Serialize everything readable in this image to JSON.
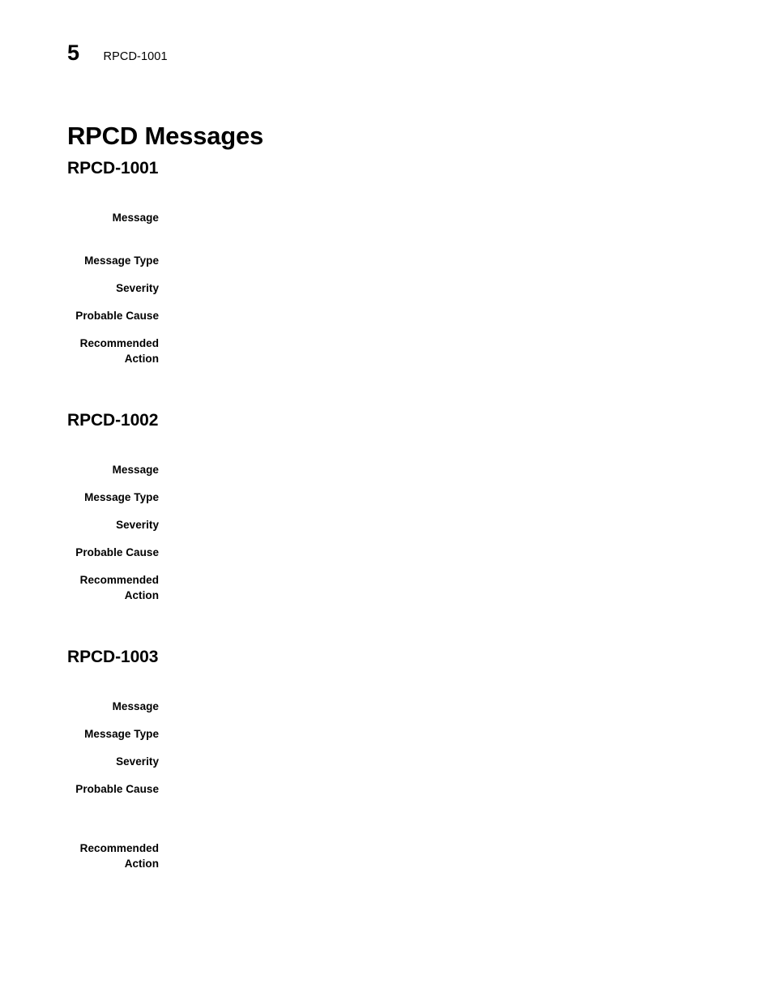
{
  "header": {
    "chapter_number": "5",
    "running_title": "RPCD-1001"
  },
  "chapter_title": "RPCD Messages",
  "labels": {
    "message": "Message",
    "message_type": "Message Type",
    "severity": "Severity",
    "probable_cause": "Probable Cause",
    "recommended_action": "Recommended\nAction"
  },
  "sections": [
    {
      "id": "RPCD-1001",
      "heading": "RPCD-1001",
      "entries": [
        {
          "label": "Message",
          "value": ""
        },
        {
          "label": "Message Type",
          "value": ""
        },
        {
          "label": "Severity",
          "value": ""
        },
        {
          "label": "Probable Cause",
          "value": ""
        },
        {
          "label": "Recommended\nAction",
          "value": ""
        }
      ]
    },
    {
      "id": "RPCD-1002",
      "heading": "RPCD-1002",
      "entries": [
        {
          "label": "Message",
          "value": ""
        },
        {
          "label": "Message Type",
          "value": ""
        },
        {
          "label": "Severity",
          "value": ""
        },
        {
          "label": "Probable Cause",
          "value": ""
        },
        {
          "label": "Recommended\nAction",
          "value": ""
        }
      ]
    },
    {
      "id": "RPCD-1003",
      "heading": "RPCD-1003",
      "entries": [
        {
          "label": "Message",
          "value": ""
        },
        {
          "label": "Message Type",
          "value": ""
        },
        {
          "label": "Severity",
          "value": ""
        },
        {
          "label": "Probable Cause",
          "value": ""
        },
        {
          "label": "Recommended\nAction",
          "value": ""
        }
      ]
    }
  ],
  "colors": {
    "page_background": "#ffffff",
    "text": "#000000"
  }
}
